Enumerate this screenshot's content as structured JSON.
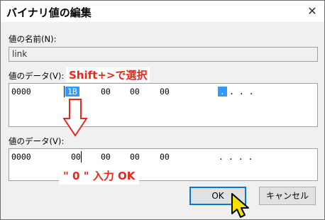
{
  "dialog": {
    "title": "バイナリ値の編集",
    "close_glyph": "✕"
  },
  "value_name": {
    "label": "値の名前(N):",
    "value": "link"
  },
  "value_data_before": {
    "label": "値のデータ(V):",
    "address": "0000",
    "bytes": [
      "1B",
      "00",
      "00",
      "00"
    ],
    "ascii_selected": ".",
    "ascii_rest": ". . ."
  },
  "value_data_after": {
    "label": "値のデータ(V):",
    "address": "0000",
    "bytes": [
      "00",
      "00",
      "00",
      "00"
    ],
    "ascii": ". . . ."
  },
  "annotations": {
    "shift_select": "Shift+>で選択",
    "enter_zero": "\" 0 \" 入力 OK"
  },
  "buttons": {
    "ok": "OK",
    "cancel": "キャンセル"
  },
  "colors": {
    "selection": "#3399ff",
    "annotation": "#e8271a",
    "cursor": "#f5e000"
  },
  "icons": [
    "close-icon",
    "down-arrow-icon",
    "mouse-pointer-icon"
  ]
}
